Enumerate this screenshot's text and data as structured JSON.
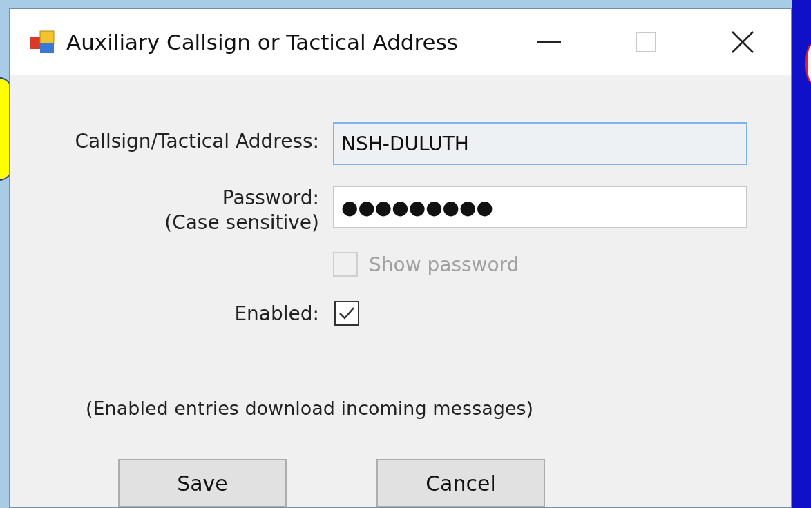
{
  "window": {
    "title": "Auxiliary Callsign or Tactical Address"
  },
  "fields": [
    {
      "label": "Callsign/Tactical Address:",
      "value": "NSH-DULUTH",
      "focused": true
    },
    {
      "label": "Password:",
      "sublabel": "(Case sensitive)",
      "value": "●●●●●●●●●",
      "focused": false
    }
  ],
  "show_password": {
    "label": "Show password",
    "checked": false,
    "disabled": true
  },
  "enabled": {
    "label": "Enabled:",
    "checked": true
  },
  "note": "(Enabled entries download incoming messages)",
  "buttons": [
    "Save",
    "Cancel"
  ]
}
